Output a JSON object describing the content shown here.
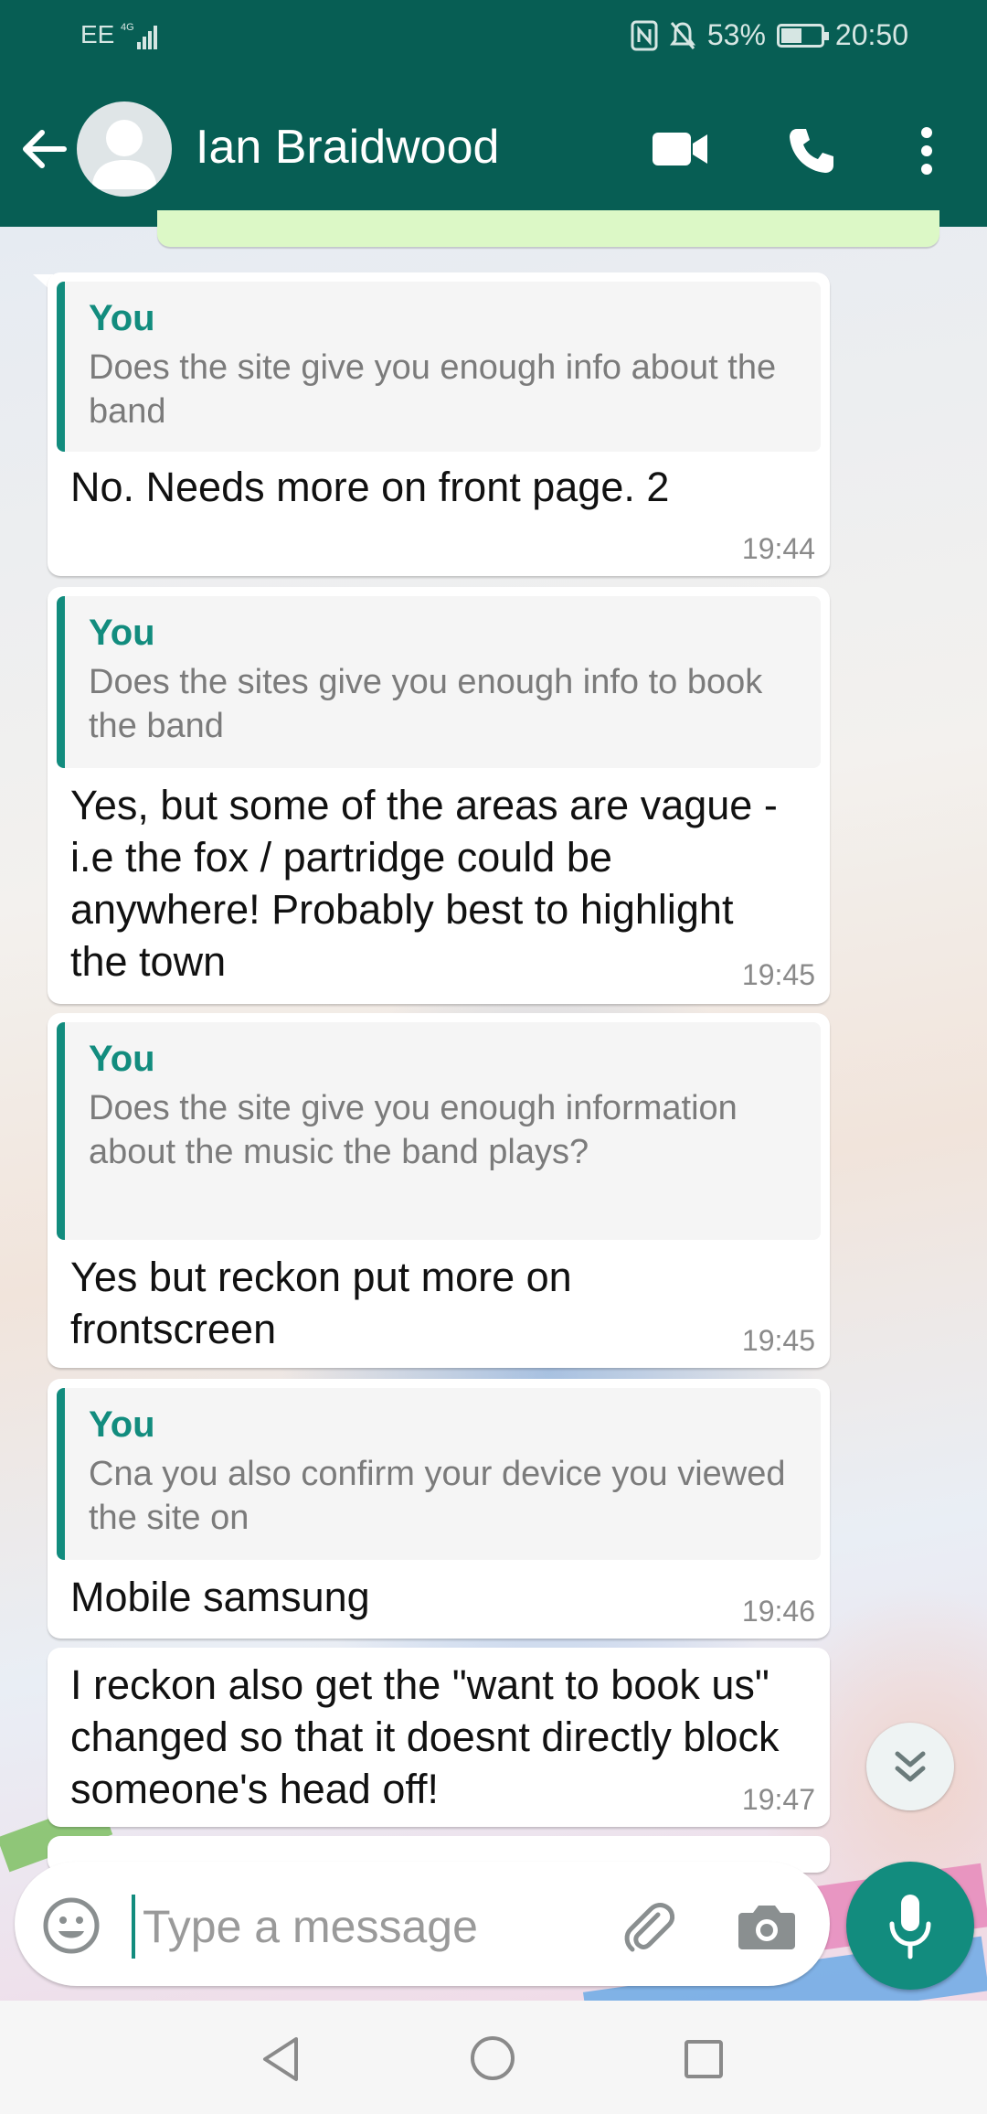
{
  "status_bar": {
    "carrier": "EE",
    "network": "4G",
    "battery": "53%",
    "battery_level": 0.53,
    "time": "20:50"
  },
  "header": {
    "contact_name": "Ian Braidwood"
  },
  "messages": [
    {
      "quote_author": "You",
      "quote_text": "Does the site give you enough info about the band",
      "text": "No. Needs more on front page. 2",
      "time": "19:44"
    },
    {
      "quote_author": "You",
      "quote_text": "Does the sites give you enough info to book the band",
      "text": "Yes, but some of the areas are vague - i.e the fox / partridge could be anywhere! Probably best to highlight the town",
      "time": "19:45"
    },
    {
      "quote_author": "You",
      "quote_text": "Does the site give you enough information about the music the band plays?",
      "text": "Yes but reckon put more on frontscreen",
      "time": "19:45"
    },
    {
      "quote_author": "You",
      "quote_text": "Cna you also confirm your device you viewed the site on",
      "text": "Mobile samsung",
      "time": "19:46"
    },
    {
      "text": "I reckon also get the \"want to book us\" changed so that it doesnt directly block someone's head off!",
      "time": "19:47"
    }
  ],
  "input": {
    "placeholder": "Type a message",
    "value": ""
  },
  "colors": {
    "header": "#075e54",
    "accent": "#128c7e",
    "outgoing_bubble": "#dcf8c6",
    "incoming_bubble": "#ffffff"
  },
  "icons": {
    "back": "arrow-left-icon",
    "video": "video-camera-icon",
    "call": "phone-icon",
    "menu": "more-vertical-icon",
    "emoji": "smiley-icon",
    "attach": "paperclip-icon",
    "camera": "camera-icon",
    "mic": "microphone-icon",
    "scroll": "double-chevron-down-icon"
  }
}
